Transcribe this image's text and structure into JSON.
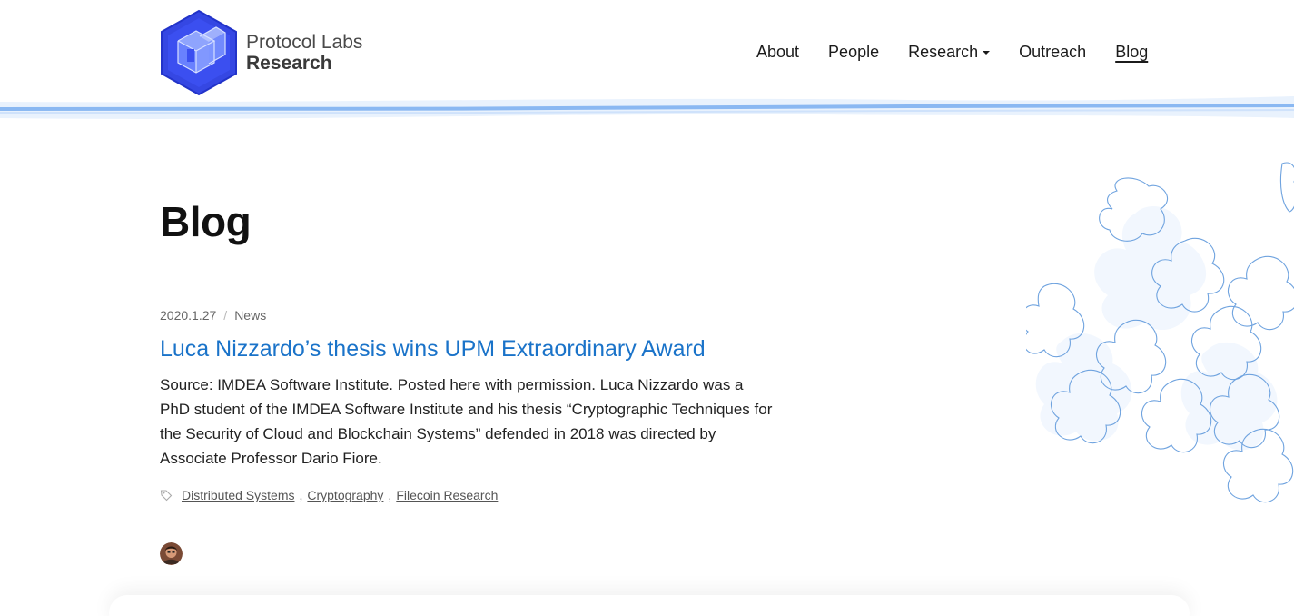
{
  "header": {
    "logo_line1": "Protocol Labs",
    "logo_line2": "Research",
    "nav": [
      {
        "label": "About"
      },
      {
        "label": "People"
      },
      {
        "label": "Research"
      },
      {
        "label": "Outreach"
      },
      {
        "label": "Blog",
        "active": true
      }
    ]
  },
  "page": {
    "title": "Blog"
  },
  "post": {
    "date": "2020.1.27",
    "separator": "/",
    "category": "News",
    "title": "Luca Nizzardo’s thesis wins UPM Extraordinary Award",
    "excerpt": "Source: IMDEA Software Institute. Posted here with permission. Luca Nizzardo was a PhD student of the IMDEA Software Institute and his thesis “Cryptographic Techniques for the Security of Cloud and Blockchain Systems” defended in 2018 was directed by Associate Professor Dario Fiore.",
    "tags": [
      "Distributed Systems",
      "Cryptography",
      "Filecoin Research"
    ],
    "tag_separator": ","
  },
  "colors": {
    "brand_blue": "#2e3fe0",
    "link_blue": "#1a73c9",
    "wave_blue": "#8ab8f2",
    "pattern_blue": "#6fa3df"
  },
  "icons": {
    "logo": "protocol-labs-cube-icon",
    "tag": "tag-icon",
    "dropdown": "caret-down-icon"
  }
}
